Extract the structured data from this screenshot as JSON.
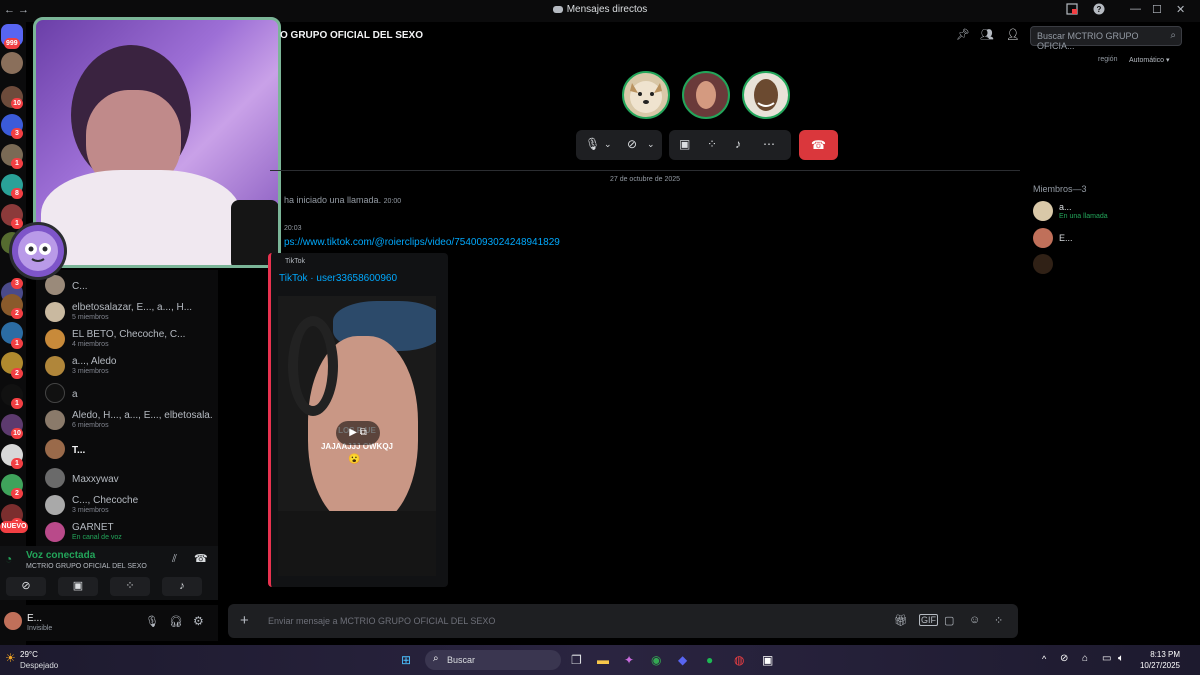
{
  "titlebar": {
    "title": "Mensajes directos",
    "back": "←",
    "forward": "→"
  },
  "rail": {
    "badges": [
      "999",
      "10",
      "3",
      "1",
      "8",
      "1",
      "1",
      "3",
      "2",
      "1",
      "2",
      "1",
      "10",
      "1",
      "2",
      "1"
    ],
    "new_label": "NUEVO"
  },
  "dm_list": [
    {
      "name": "C...",
      "sub": ""
    },
    {
      "name": "elbetosalazar, E..., a..., H...",
      "sub": "5 miembros"
    },
    {
      "name": "EL BETO, Checoche, C...",
      "sub": "4 miembros"
    },
    {
      "name": "a..., Aledo",
      "sub": "3 miembros"
    },
    {
      "name": "a",
      "sub": ""
    },
    {
      "name": "Aledo, H..., a..., E..., elbetosala...",
      "sub": "6 miembros"
    },
    {
      "name": "T...",
      "sub": ""
    },
    {
      "name": "Maxxywav",
      "sub": ""
    },
    {
      "name": "C..., Checoche",
      "sub": "3 miembros"
    },
    {
      "name": "GARNET",
      "sub": "En canal de voz"
    }
  ],
  "voice": {
    "status": "Voz conectada",
    "channel": "MCTRIO GRUPO OFICIAL DEL SEXO"
  },
  "user": {
    "name": "E...",
    "status": "Invisible"
  },
  "header": {
    "channel_title": "O GRUPO OFICIAL DEL SEXO",
    "search_placeholder": "Buscar MCTRIO GRUPO OFICIA...",
    "region_label": "región",
    "region_value": "Automático"
  },
  "messages": {
    "date": "27 de octubre de 2025",
    "call_started": "ha iniciado una llamada.",
    "call_time": "20:00",
    "time2": "20:03",
    "link": "ps://www.tiktok.com/@roierclips/video/7540093024248941829",
    "embed_provider": "TikTok",
    "embed_title": "TikTok · user33658600960",
    "video_caption_1": "LOS R UE",
    "video_caption_2": "JAJAAJJJ OWKQJ",
    "video_emoji": "😮"
  },
  "members": {
    "header": "Miembros—3",
    "list": [
      {
        "name": "a...",
        "status": "En una llamada"
      },
      {
        "name": "E...",
        "status": ""
      },
      {
        "name": "",
        "status": ""
      }
    ]
  },
  "composer": {
    "placeholder": "Enviar mensaje a MCTRIO GRUPO OFICIAL DEL SEXO"
  },
  "taskbar": {
    "weather_temp": "29°C",
    "weather_desc": "Despejado",
    "search": "Buscar",
    "time": "8:13 PM",
    "date": "10/27/2025"
  },
  "colors": {
    "accent_green": "#23a55a",
    "hangup_red": "#da373c",
    "embed_border": "#e9324f",
    "badge_red": "#f23f43"
  }
}
